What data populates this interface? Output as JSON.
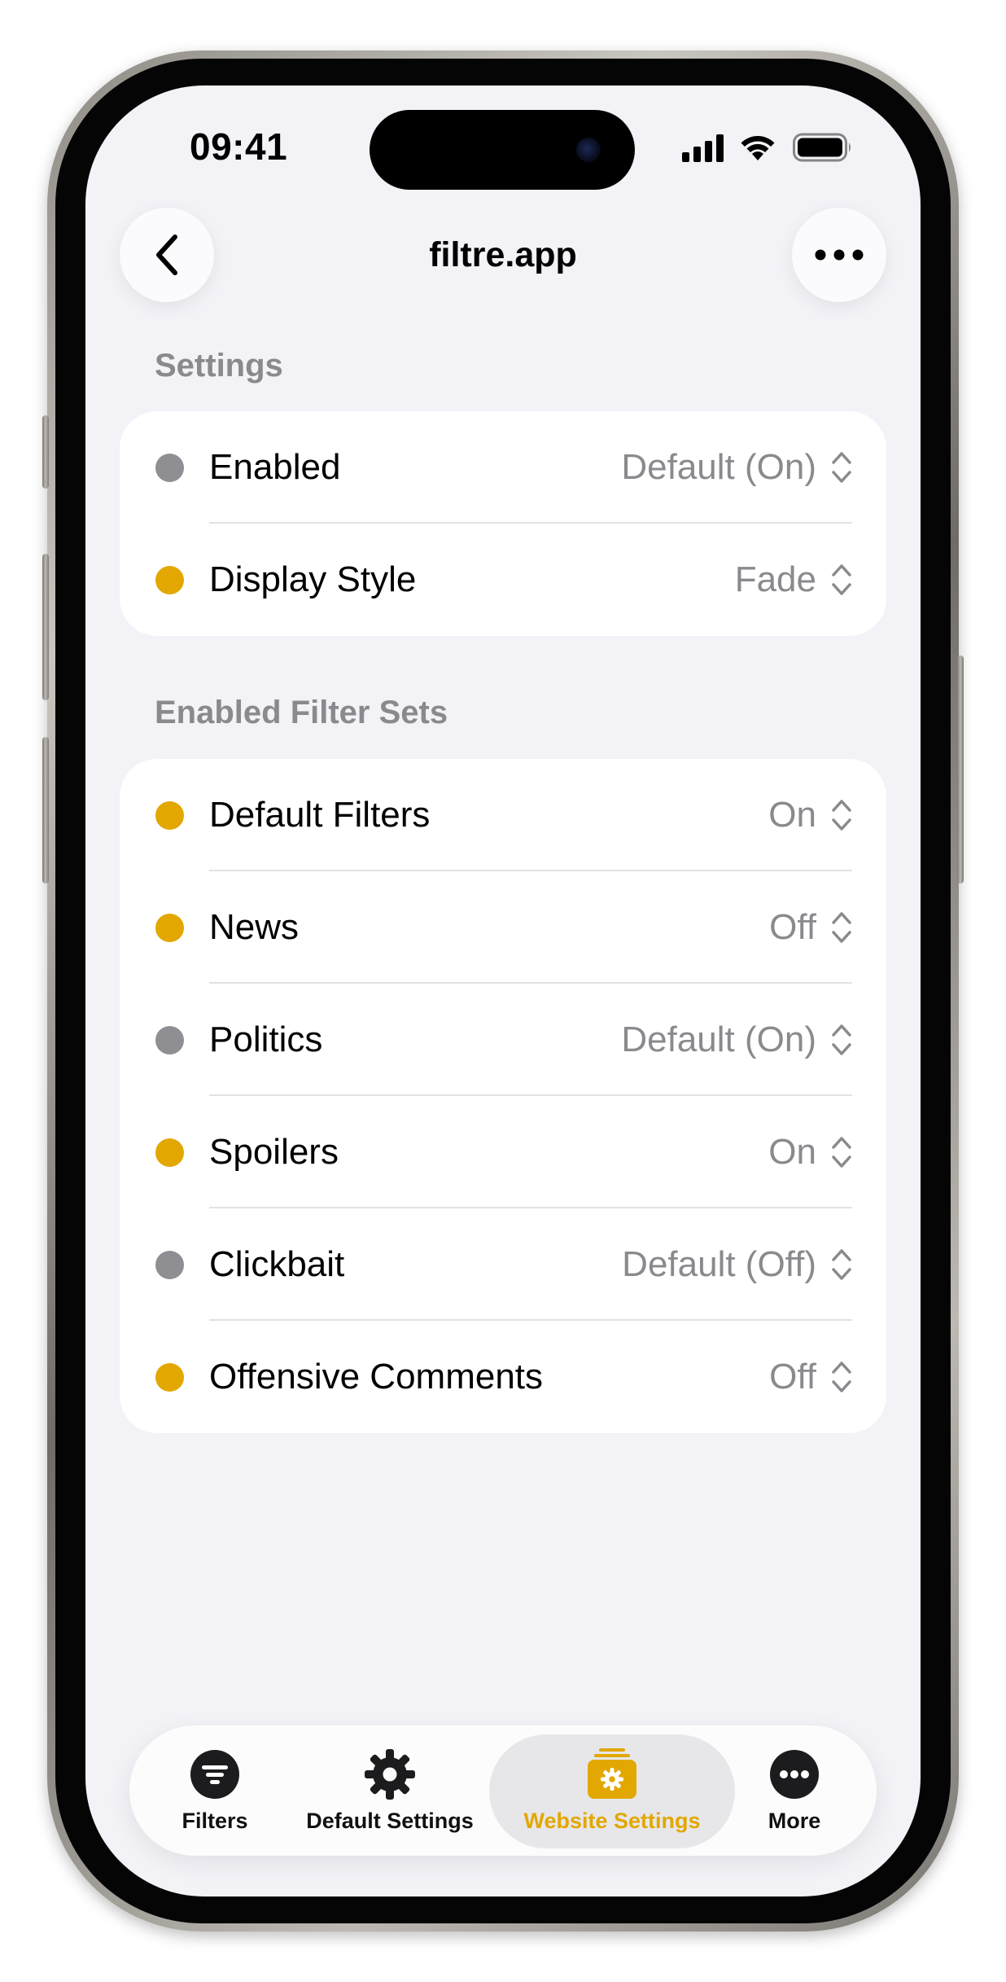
{
  "status_bar": {
    "time": "09:41"
  },
  "nav": {
    "title": "filtre.app"
  },
  "icons": {
    "back": "chevron-left-icon",
    "more": "ellipsis-icon",
    "status": [
      "cellular-signal-icon",
      "wifi-icon",
      "battery-icon"
    ],
    "chevron": "chevron-up-down-icon"
  },
  "colors": {
    "accent": "#e2a700",
    "default_dot": "#8e8e93",
    "secondary_text": "#8a8a8e",
    "background": "#f2f2f7"
  },
  "settings": {
    "header": "Settings",
    "rows": [
      {
        "label": "Enabled",
        "value": "Default (On)",
        "dot": "gray"
      },
      {
        "label": "Display Style",
        "value": "Fade",
        "dot": "yellow"
      }
    ]
  },
  "filter_sets": {
    "header": "Enabled Filter Sets",
    "rows": [
      {
        "label": "Default Filters",
        "value": "On",
        "dot": "yellow"
      },
      {
        "label": "News",
        "value": "Off",
        "dot": "yellow"
      },
      {
        "label": "Politics",
        "value": "Default (On)",
        "dot": "gray"
      },
      {
        "label": "Spoilers",
        "value": "On",
        "dot": "yellow"
      },
      {
        "label": "Clickbait",
        "value": "Default (Off)",
        "dot": "gray"
      },
      {
        "label": "Offensive Comments",
        "value": "Off",
        "dot": "yellow"
      }
    ]
  },
  "tabbar": {
    "tabs": [
      {
        "label": "Filters",
        "icon": "filter-circle-icon",
        "active": false
      },
      {
        "label": "Default Settings",
        "icon": "gear-icon",
        "active": false
      },
      {
        "label": "Website Settings",
        "icon": "website-settings-icon",
        "active": true
      },
      {
        "label": "More",
        "icon": "ellipsis-circle-icon",
        "active": false
      }
    ]
  }
}
